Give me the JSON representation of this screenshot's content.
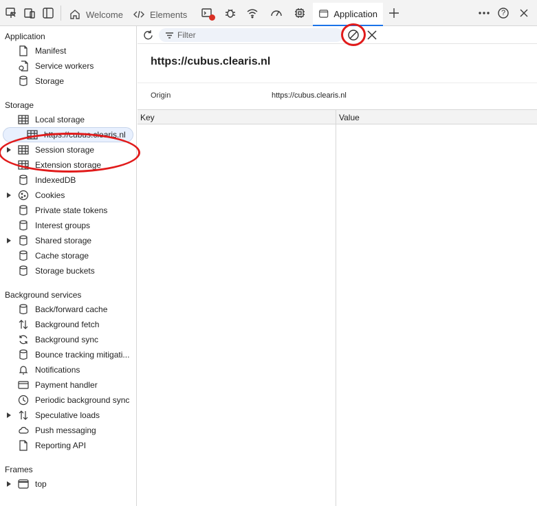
{
  "tabbar": {
    "tabs": [
      {
        "label": "Welcome",
        "icon": "home-icon"
      },
      {
        "label": "Elements",
        "icon": "code-icon"
      },
      {
        "label": "Application",
        "icon": "window-icon",
        "active": true
      }
    ],
    "help_label": "?"
  },
  "sidebar": {
    "application": {
      "title": "Application",
      "items": [
        {
          "label": "Manifest",
          "icon": "file-icon"
        },
        {
          "label": "Service workers",
          "icon": "gear-file-icon"
        },
        {
          "label": "Storage",
          "icon": "database-icon"
        }
      ]
    },
    "storage": {
      "title": "Storage",
      "items": [
        {
          "label": "Local storage",
          "icon": "table-icon",
          "expanded": true
        },
        {
          "label": "https://cubus.clearis.nl",
          "icon": "table-icon",
          "selected": true
        },
        {
          "label": "Session storage",
          "icon": "table-icon"
        },
        {
          "label": "Extension storage",
          "icon": "table-icon"
        },
        {
          "label": "IndexedDB",
          "icon": "database-icon"
        },
        {
          "label": "Cookies",
          "icon": "cookie-icon"
        },
        {
          "label": "Private state tokens",
          "icon": "database-icon"
        },
        {
          "label": "Interest groups",
          "icon": "database-icon"
        },
        {
          "label": "Shared storage",
          "icon": "database-icon"
        },
        {
          "label": "Cache storage",
          "icon": "database-icon"
        },
        {
          "label": "Storage buckets",
          "icon": "database-icon"
        }
      ]
    },
    "background": {
      "title": "Background services",
      "items": [
        {
          "label": "Back/forward cache",
          "icon": "database-icon"
        },
        {
          "label": "Background fetch",
          "icon": "updown-arrows-icon"
        },
        {
          "label": "Background sync",
          "icon": "sync-icon"
        },
        {
          "label": "Bounce tracking mitigati...",
          "icon": "database-icon"
        },
        {
          "label": "Notifications",
          "icon": "bell-icon"
        },
        {
          "label": "Payment handler",
          "icon": "card-icon"
        },
        {
          "label": "Periodic background sync",
          "icon": "clock-icon"
        },
        {
          "label": "Speculative loads",
          "icon": "updown-arrows-icon"
        },
        {
          "label": "Push messaging",
          "icon": "cloud-icon"
        },
        {
          "label": "Reporting API",
          "icon": "file-icon"
        }
      ]
    },
    "frames": {
      "title": "Frames",
      "items": [
        {
          "label": "top",
          "icon": "frame-icon"
        }
      ]
    }
  },
  "main": {
    "filter_placeholder": "Filter",
    "origin_heading": "https://cubus.clearis.nl",
    "origin_label": "Origin",
    "origin_value": "https://cubus.clearis.nl",
    "columns": {
      "key": "Key",
      "value": "Value"
    },
    "rows": []
  },
  "annotation_color": "#e11b1b",
  "accent_color": "#1a73e8"
}
